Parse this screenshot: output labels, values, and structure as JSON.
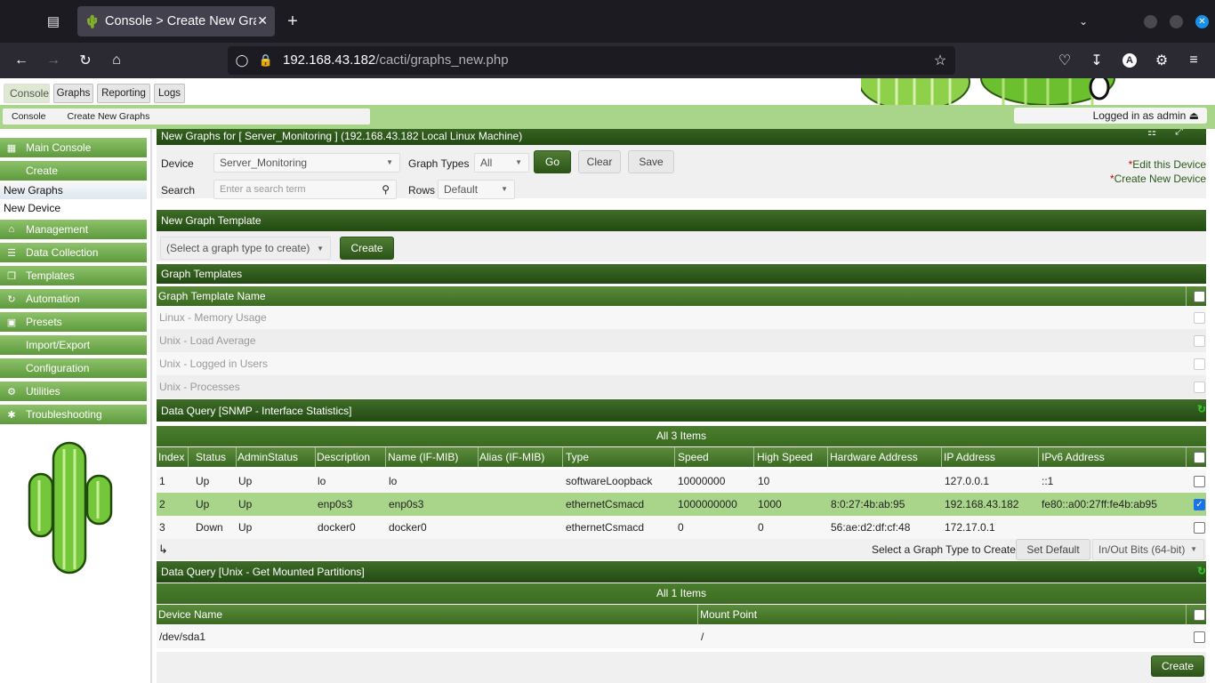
{
  "browser": {
    "tab_title": "Console > Create New Graphs",
    "url_host": "192.168.43.182",
    "url_path": "/cacti/graphs_new.php"
  },
  "topnav": {
    "tabs": [
      "Console",
      "Graphs",
      "Reporting",
      "Logs"
    ]
  },
  "breadcrumb": [
    "Console",
    "Create New Graphs"
  ],
  "login_text": "Logged in as admin ⏏",
  "sidebar": {
    "main_console": "Main Console",
    "create": "Create",
    "new_graphs": "New Graphs",
    "new_device": "New Device",
    "management": "Management",
    "data_collection": "Data Collection",
    "templates": "Templates",
    "automation": "Automation",
    "presets": "Presets",
    "import_export": "Import/Export",
    "configuration": "Configuration",
    "utilities": "Utilities",
    "troubleshooting": "Troubleshooting"
  },
  "filter": {
    "title": "New Graphs for [ Server_Monitoring ] (192.168.43.182 Local Linux Machine)",
    "device_label": "Device",
    "device_value": "Server_Monitoring",
    "graph_types_label": "Graph Types",
    "graph_types_value": "All",
    "go": "Go",
    "clear": "Clear",
    "save": "Save",
    "search_label": "Search",
    "search_placeholder": "Enter a search term",
    "rows_label": "Rows",
    "rows_value": "Default",
    "edit_device": "Edit this Device",
    "create_device": "Create New Device",
    "star": "*"
  },
  "new_template": {
    "title": "New Graph Template",
    "select": "(Select a graph type to create)",
    "create": "Create"
  },
  "graph_templates": {
    "title": "Graph Templates",
    "column": "Graph Template Name",
    "rows": [
      "Linux - Memory Usage",
      "Unix - Load Average",
      "Unix - Logged in Users",
      "Unix - Processes"
    ]
  },
  "snmp": {
    "title": "Data Query [SNMP - Interface Statistics]",
    "count": "All 3 Items",
    "columns": [
      "Index",
      "Status",
      "AdminStatus",
      "Description",
      "Name (IF-MIB)",
      "Alias (IF-MIB)",
      "Type",
      "Speed",
      "High Speed",
      "Hardware Address",
      "IP Address",
      "IPv6 Address"
    ],
    "rows": [
      [
        "1",
        "Up",
        "Up",
        "lo",
        "lo",
        "",
        "softwareLoopback",
        "10000000",
        "10",
        "",
        "127.0.0.1",
        "::1"
      ],
      [
        "2",
        "Up",
        "Up",
        "enp0s3",
        "enp0s3",
        "",
        "ethernetCsmacd",
        "1000000000",
        "1000",
        "8:0:27:4b:ab:95",
        "192.168.43.182",
        "fe80::a00:27ff:fe4b:ab95"
      ],
      [
        "3",
        "Down",
        "Up",
        "docker0",
        "docker0",
        "",
        "ethernetCsmacd",
        "0",
        "0",
        "56:ae:d2:df:cf:48",
        "172.17.0.1",
        ""
      ]
    ],
    "select_label": "Select a Graph Type to Create",
    "set_default": "Set Default",
    "graph_type": "In/Out Bits (64-bit)"
  },
  "partitions": {
    "title": "Data Query [Unix - Get Mounted Partitions]",
    "count": "All 1 Items",
    "columns": [
      "Device Name",
      "Mount Point"
    ],
    "rows": [
      [
        "/dev/sda1",
        "/"
      ]
    ]
  },
  "create_button": "Create",
  "colors": {
    "accent_green": "#3f6d28",
    "selected_row": "#a9d58a",
    "checkbox_blue": "#1a73e8"
  }
}
